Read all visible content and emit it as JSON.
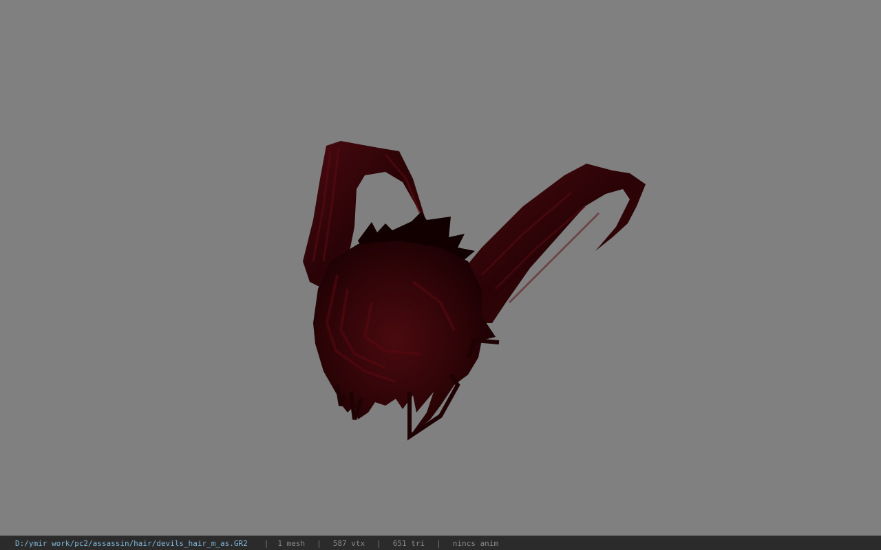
{
  "viewport": {
    "background_color": "#808080",
    "model": {
      "icon": "devil-horns-hair-model",
      "fill_dark": "#1a0000",
      "fill_mid": "#3a0508",
      "fill_light": "#5a0a10"
    }
  },
  "status_bar": {
    "file_path": "D:/ymir work/pc2/assassin/hair/devils_hair_m_as.GR2",
    "separator": "|",
    "mesh_count": "1 mesh",
    "vertex_count": "587 vtx",
    "triangle_count": "651 tri",
    "anim_status": "nincs anim"
  }
}
